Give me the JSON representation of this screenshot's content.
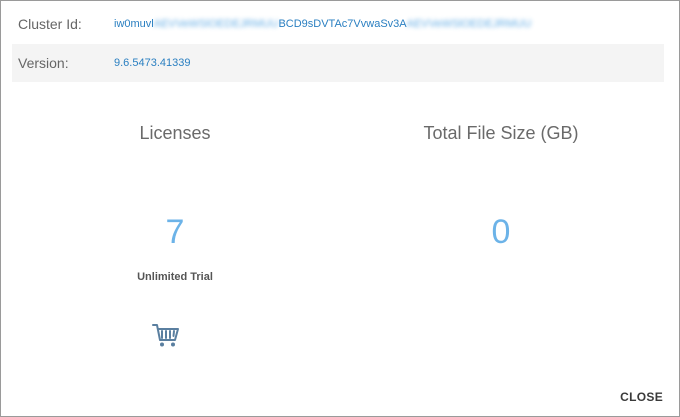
{
  "cluster": {
    "label": "Cluster Id:",
    "value_prefix": "iw0muvl",
    "value_blur_a": "AEVVeWSlOEDEJRMUU",
    "value_mid": "BCD9sDVTAc7VvwaSv3A",
    "value_blur_b": "AEVVeWSlOEDEJRMUU"
  },
  "version": {
    "label": "Version:",
    "value": "9.6.5473.41339"
  },
  "licenses": {
    "title": "Licenses",
    "count": "7",
    "type": "Unlimited Trial",
    "cart_icon": "shopping-cart-icon"
  },
  "file_size": {
    "title": "Total File Size (GB)",
    "value": "0"
  },
  "footer": {
    "close_label": "CLOSE"
  },
  "colors": {
    "accent": "#6cb3e8",
    "link": "#2a7fc1",
    "cart_icon": "#5a7fa0"
  }
}
